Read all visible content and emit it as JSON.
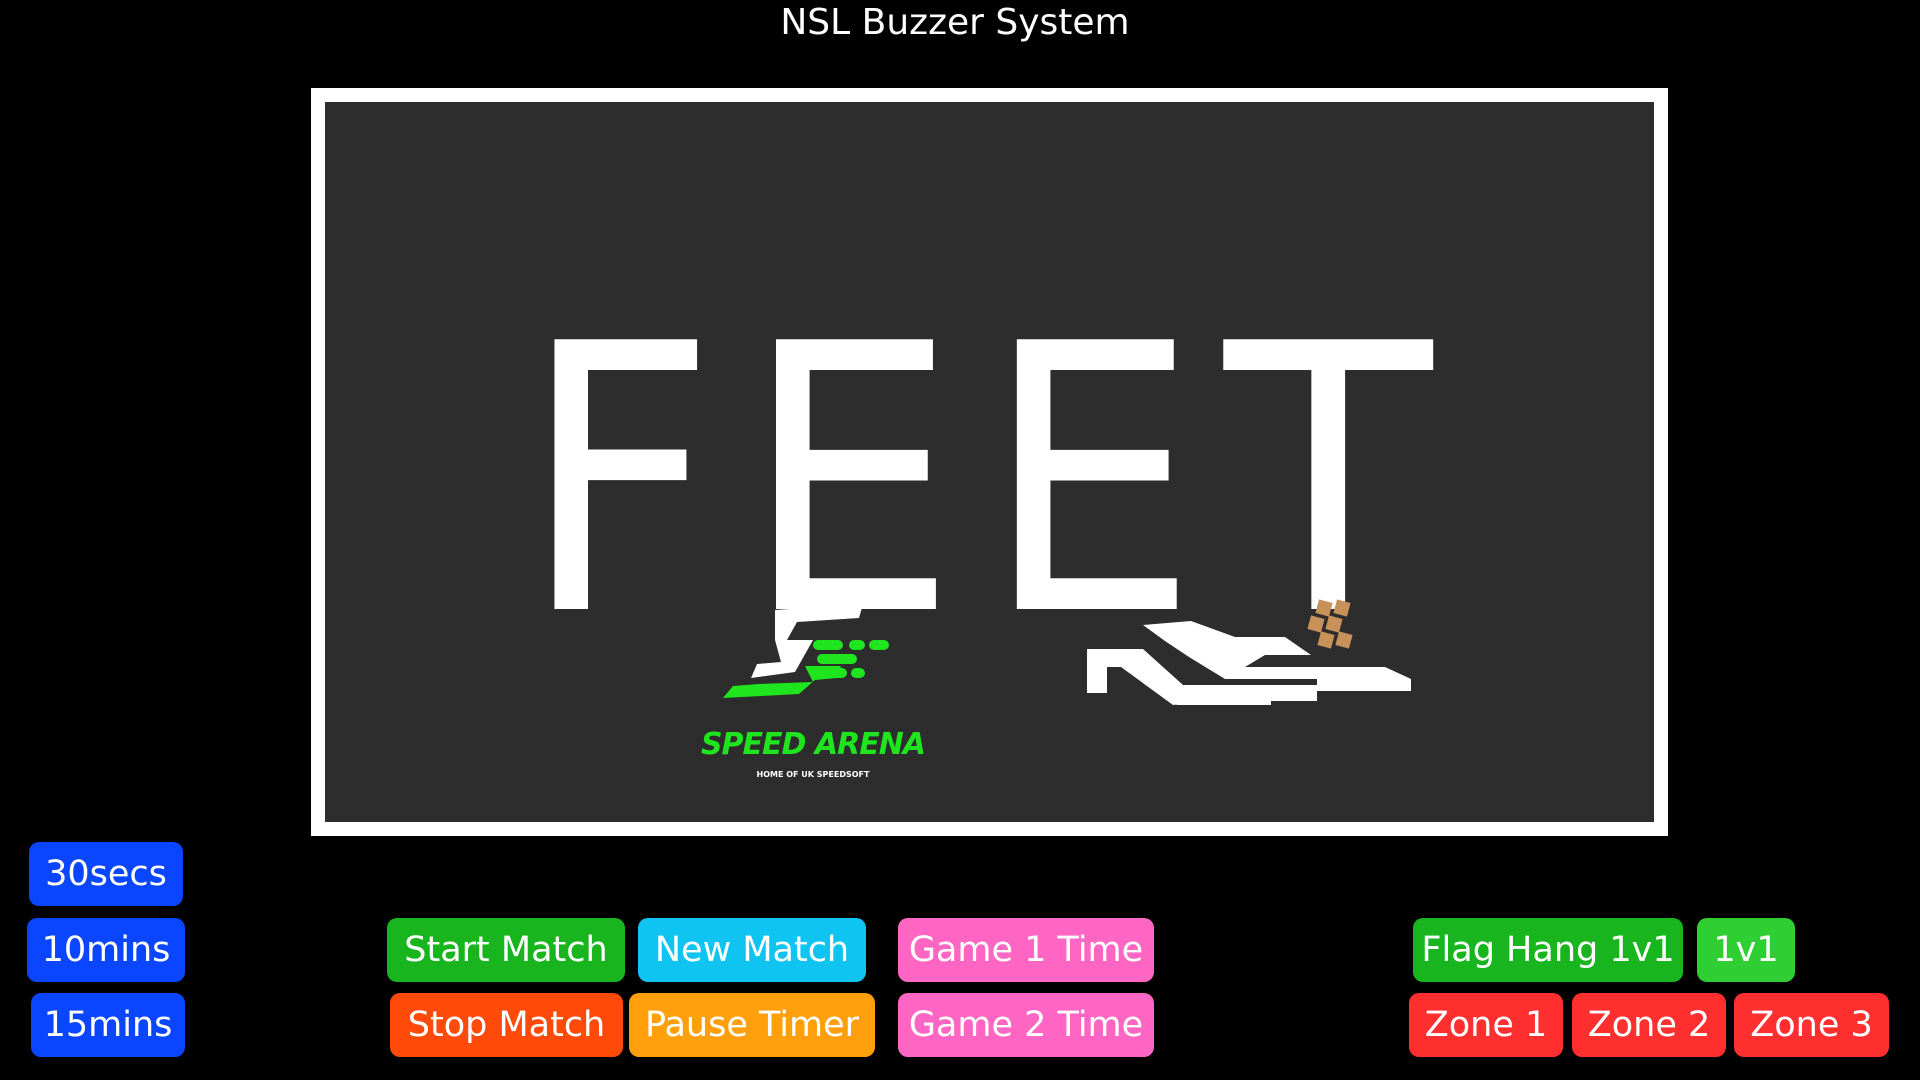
{
  "app": {
    "title": "NSL Buzzer System"
  },
  "display": {
    "message": "FEET",
    "logos": {
      "speed_arena_name": "SPEED ARENA",
      "speed_arena_tagline": "HOME OF UK SPEEDSOFT"
    }
  },
  "timer_presets": {
    "thirty_seconds": "30secs",
    "ten_minutes": "10mins",
    "fifteen_minutes": "15mins"
  },
  "match_controls": {
    "start": "Start Match",
    "new": "New Match",
    "stop": "Stop Match",
    "pause": "Pause Timer"
  },
  "game_times": {
    "game1": "Game 1 Time",
    "game2": "Game 2 Time"
  },
  "modes": {
    "flag_hang": "Flag Hang 1v1",
    "one_v_one": "1v1",
    "zone1": "Zone 1",
    "zone2": "Zone 2",
    "zone3": "Zone 3"
  },
  "colors": {
    "background": "#000000",
    "display_panel": "#2d2d2d",
    "blue": "#0a46ff",
    "green": "#19b51f",
    "cyan": "#10c4f2",
    "pink": "#ff66c4",
    "orange_red": "#ff4a09",
    "orange": "#ff9f0c",
    "red": "#ff2f2f",
    "lime": "#2fcf34",
    "logo_green": "#1fe51f",
    "logo_tan": "#c8915a"
  }
}
